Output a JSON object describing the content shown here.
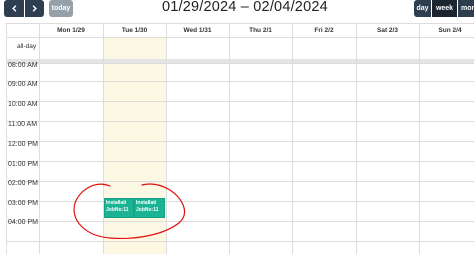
{
  "toolbar": {
    "prev_icon": "chevron-left-icon",
    "next_icon": "chevron-right-icon",
    "today_label": "today",
    "title": "01/29/2024 – 02/04/2024",
    "views": {
      "day": "day",
      "week": "week",
      "month": "month"
    }
  },
  "columns": [
    "Mon 1/29",
    "Tue 1/30",
    "Wed 1/31",
    "Thu 2/1",
    "Fri 2/2",
    "Sat 2/3",
    "Sun 2/4"
  ],
  "allday_label": "all-day",
  "time_slots": [
    "08:00 AM",
    "09:00 AM",
    "10:00 AM",
    "11:00 AM",
    "12:00 PM",
    "01:00 PM",
    "02:00 PM",
    "03:00 PM",
    "04:00 PM"
  ],
  "events": [
    {
      "line1": "Installati",
      "line2": "JobNo:11"
    },
    {
      "line1": "Installati",
      "line2": "JobNo:11"
    }
  ],
  "colors": {
    "button": "#2c3e50",
    "button_active": "#1a252f",
    "today_button": "#95a0ab",
    "today_column": "#fcf8e3",
    "event": "#1ab394",
    "annotation": "#e01010"
  }
}
